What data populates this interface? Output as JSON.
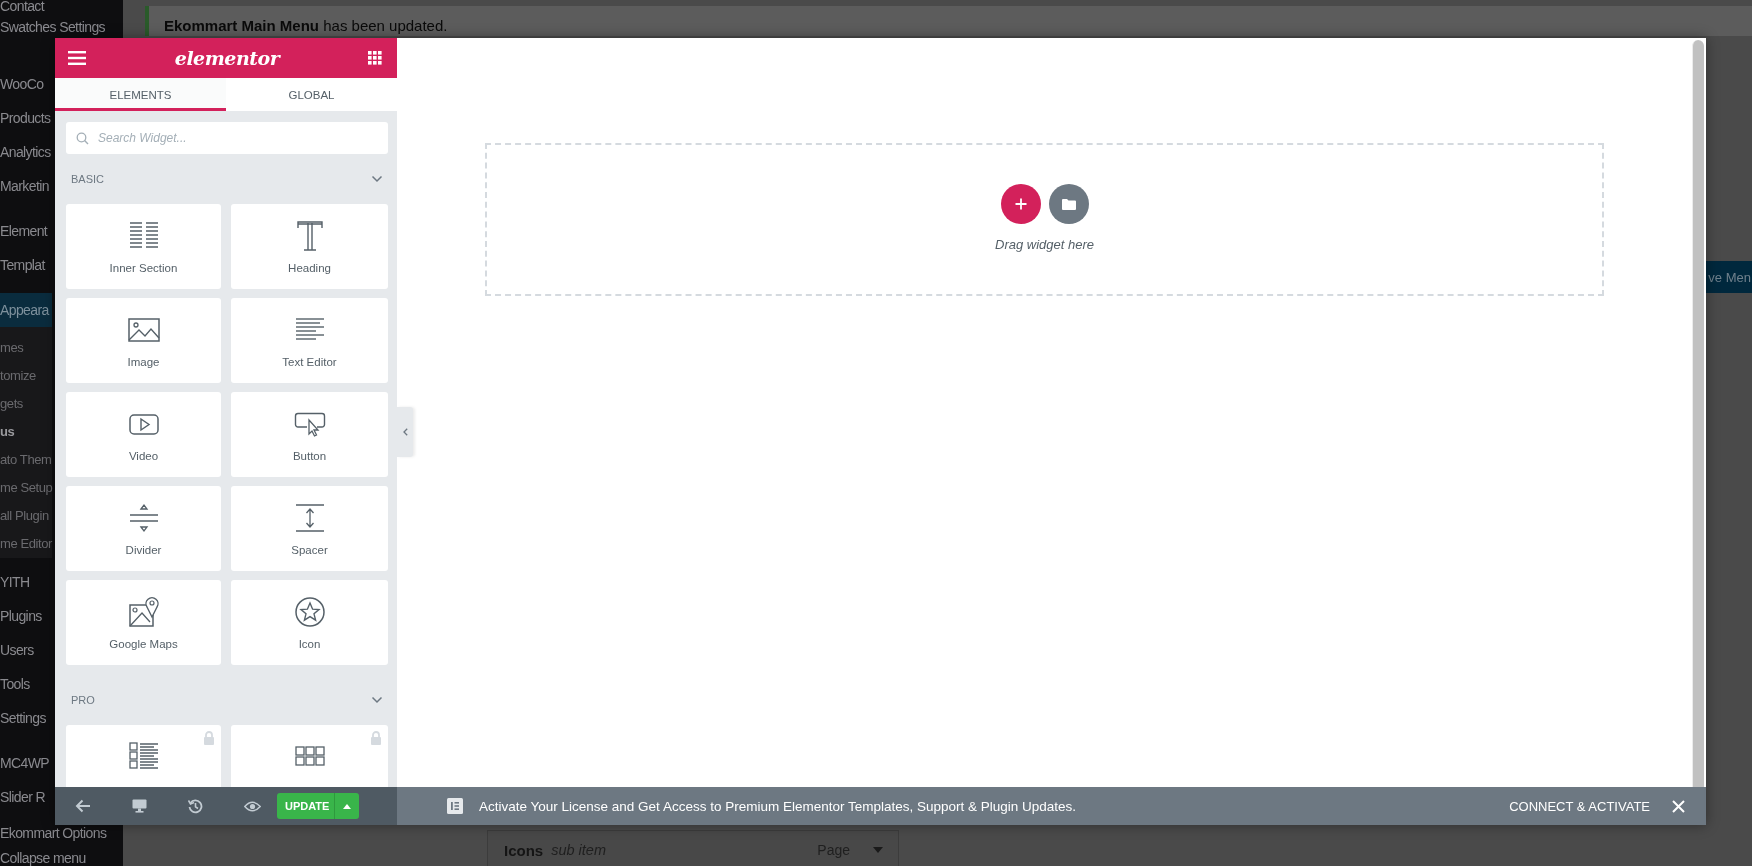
{
  "wp_admin": {
    "sidebar": {
      "items": [
        {
          "kind": "menu",
          "label": "Contact",
          "selected": false
        },
        {
          "kind": "menu",
          "label": "Swatches Settings",
          "selected": false
        },
        {
          "kind": "separator"
        },
        {
          "kind": "menu",
          "label": "WooCo",
          "selected": false
        },
        {
          "kind": "menu",
          "label": "Products",
          "selected": false
        },
        {
          "kind": "menu",
          "label": "Analytics",
          "selected": false
        },
        {
          "kind": "menu",
          "label": "Marketin",
          "selected": false
        },
        {
          "kind": "separator"
        },
        {
          "kind": "menu",
          "label": "Element",
          "selected": false
        },
        {
          "kind": "menu",
          "label": "Templat",
          "selected": false
        },
        {
          "kind": "separator"
        },
        {
          "kind": "menu",
          "label": "Appeara",
          "selected": true
        },
        {
          "kind": "submenu",
          "label": "mes",
          "selected": false
        },
        {
          "kind": "submenu",
          "label": "tomize",
          "selected": false
        },
        {
          "kind": "submenu",
          "label": "gets",
          "selected": false
        },
        {
          "kind": "submenu",
          "label": "us",
          "selected": true
        },
        {
          "kind": "submenu",
          "label": "ato Them",
          "selected": false
        },
        {
          "kind": "submenu",
          "label": "me Setup",
          "selected": false
        },
        {
          "kind": "submenu",
          "label": "all Plugin",
          "selected": false
        },
        {
          "kind": "submenu",
          "label": "me Editor",
          "selected": false
        },
        {
          "kind": "menu",
          "label": "YITH",
          "selected": false
        },
        {
          "kind": "menu",
          "label": "Plugins",
          "selected": false
        },
        {
          "kind": "menu",
          "label": "Users",
          "selected": false
        },
        {
          "kind": "menu",
          "label": "Tools",
          "selected": false
        },
        {
          "kind": "menu",
          "label": "Settings",
          "selected": false
        },
        {
          "kind": "separator"
        },
        {
          "kind": "menu",
          "label": "MC4WP",
          "selected": false
        },
        {
          "kind": "menu",
          "label": "Slider R",
          "selected": false
        },
        {
          "kind": "menu",
          "label": "Ekommart Options",
          "selected": false
        },
        {
          "kind": "menu",
          "label": "Collapse menu",
          "selected": false
        }
      ]
    },
    "notice": {
      "text": "**Ekommart Main Menu** has been updated."
    },
    "save_button": "ve Men",
    "menu_item": {
      "title": "Icons",
      "subtitle": "sub item",
      "type": "Page"
    }
  },
  "editor": {
    "panel": {
      "logo": "elementor",
      "tabs": [
        {
          "label": "ELEMENTS",
          "selected": true
        },
        {
          "label": "GLOBAL",
          "selected": false
        }
      ],
      "search": {
        "placeholder": "Search Widget..."
      },
      "categories": [
        {
          "title": "BASIC",
          "expanded": true,
          "widgets": [
            {
              "kind": "inner-section",
              "label": "Inner Section",
              "locked": false
            },
            {
              "kind": "heading",
              "label": "Heading",
              "locked": false
            },
            {
              "kind": "image",
              "label": "Image",
              "locked": false
            },
            {
              "kind": "text-editor",
              "label": "Text Editor",
              "locked": false
            },
            {
              "kind": "video",
              "label": "Video",
              "locked": false
            },
            {
              "kind": "button",
              "label": "Button",
              "locked": false
            },
            {
              "kind": "divider",
              "label": "Divider",
              "locked": false
            },
            {
              "kind": "spacer",
              "label": "Spacer",
              "locked": false
            },
            {
              "kind": "google-maps",
              "label": "Google Maps",
              "locked": false
            },
            {
              "kind": "icon",
              "label": "Icon",
              "locked": false
            }
          ]
        },
        {
          "title": "PRO",
          "expanded": true,
          "widgets": [
            {
              "kind": "posts",
              "locked": true
            },
            {
              "kind": "portfolio",
              "locked": true
            }
          ]
        }
      ],
      "footer": {
        "update_button": "UPDATE"
      }
    },
    "canvas": {
      "drop_hint": "Drag widget here"
    },
    "license_bar": {
      "message": "Activate Your License and Get Access to Premium Elementor Templates, Support & Plugin Updates.",
      "action": "CONNECT & ACTIVATE"
    }
  }
}
